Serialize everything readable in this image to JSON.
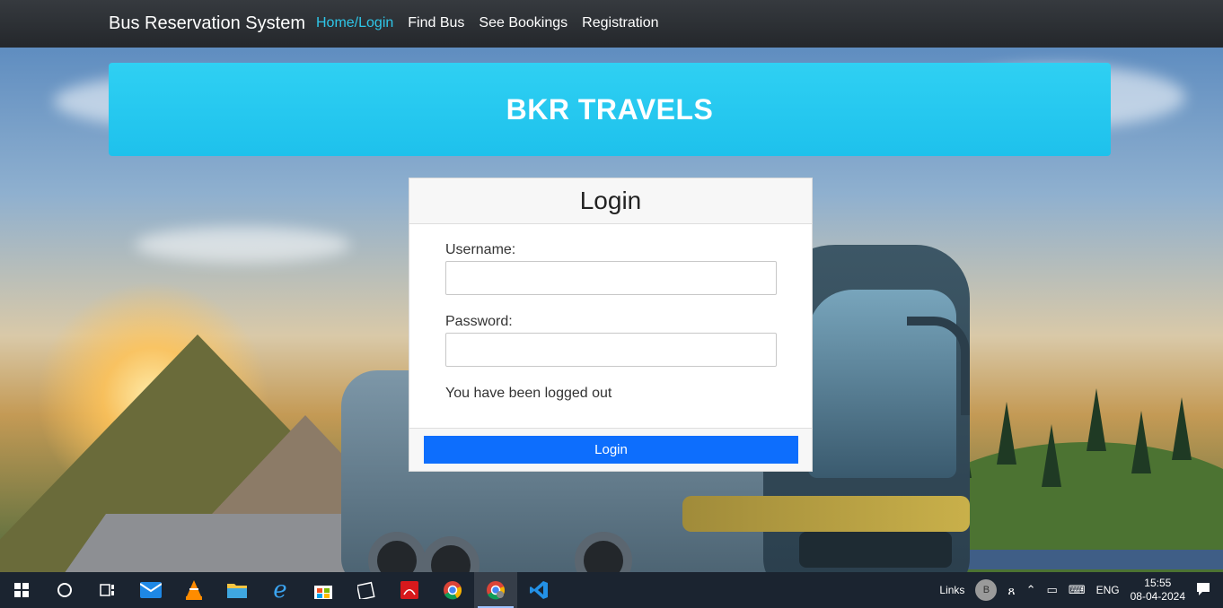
{
  "navbar": {
    "brand": "Bus Reservation System",
    "links": [
      {
        "label": "Home/Login",
        "active": true
      },
      {
        "label": "Find Bus",
        "active": false
      },
      {
        "label": "See Bookings",
        "active": false
      },
      {
        "label": "Registration",
        "active": false
      }
    ]
  },
  "banner": {
    "title": "BKR TRAVELS",
    "color": "#26c7ef"
  },
  "login": {
    "title": "Login",
    "username_label": "Username:",
    "username_value": "",
    "password_label": "Password:",
    "password_value": "",
    "status_message": "You have been logged out",
    "submit_label": "Login",
    "submit_color": "#0d6efd"
  },
  "taskbar": {
    "apps": [
      "windows-start-icon",
      "search-circle-icon",
      "task-view-icon",
      "mail-icon",
      "vlc-icon",
      "file-explorer-icon",
      "edge-icon",
      "store-icon",
      "photos-icon",
      "acrobat-icon",
      "chrome-icon",
      "chrome-profile-icon",
      "vscode-icon"
    ],
    "tray": {
      "links_label": "Links",
      "avatar_letter": "B",
      "language": "ENG",
      "time": "15:55",
      "date": "08-04-2024"
    }
  }
}
